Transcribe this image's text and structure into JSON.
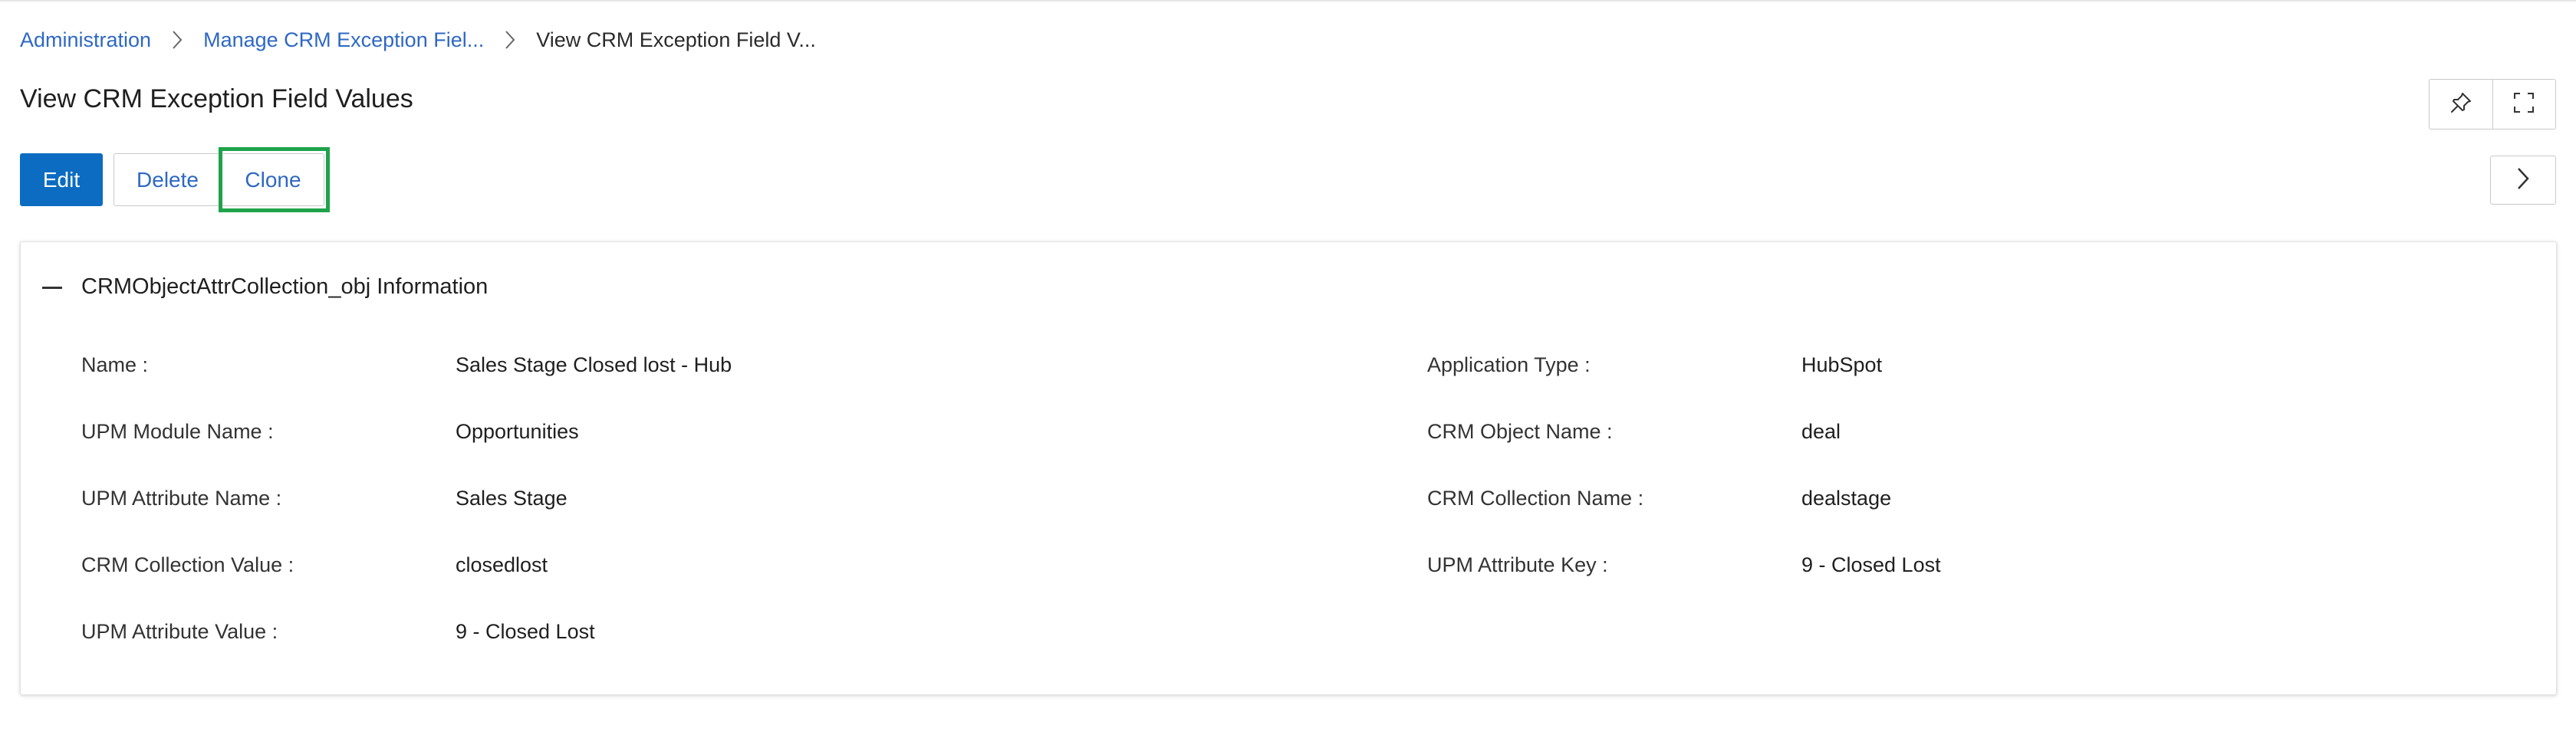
{
  "breadcrumb": {
    "items": [
      "Administration",
      "Manage CRM Exception Fiel...",
      "View CRM Exception Field V..."
    ]
  },
  "page": {
    "title": "View CRM Exception Field Values"
  },
  "toolbar": {
    "edit_label": "Edit",
    "delete_label": "Delete",
    "clone_label": "Clone"
  },
  "header_icons": [
    "pin-icon",
    "fullscreen-icon"
  ],
  "side_toggle_icon": "chevron-right-icon",
  "section": {
    "title": "CRMObjectAttrCollection_obj Information",
    "fields": [
      {
        "label": "Name :",
        "value": "Sales Stage Closed lost - Hub"
      },
      {
        "label": "Application Type :",
        "value": "HubSpot"
      },
      {
        "label": "UPM Module Name :",
        "value": "Opportunities"
      },
      {
        "label": "CRM Object Name :",
        "value": "deal"
      },
      {
        "label": "UPM Attribute Name :",
        "value": "Sales Stage"
      },
      {
        "label": "CRM Collection Name :",
        "value": "dealstage"
      },
      {
        "label": "CRM Collection Value :",
        "value": "closedlost"
      },
      {
        "label": "UPM Attribute Key :",
        "value": "9 - Closed Lost"
      },
      {
        "label": "UPM Attribute Value :",
        "value": "9 - Closed Lost"
      }
    ]
  },
  "colors": {
    "primary": "#0b6cc1",
    "link": "#2e68c4",
    "focus_ring": "#1ea34a"
  }
}
